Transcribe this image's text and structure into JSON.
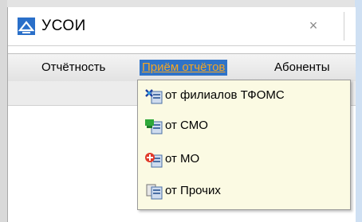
{
  "window": {
    "title": "УСОИ",
    "close_label": "×"
  },
  "menubar": {
    "items": [
      {
        "label": "Отчётность"
      },
      {
        "label": "Приём отчётов"
      },
      {
        "label": "Абоненты"
      }
    ]
  },
  "dropdown": {
    "items": [
      {
        "label": "от филиалов ТФОМС",
        "icon": "tfoms-branches-icon"
      },
      {
        "label": "от СМО",
        "icon": "smo-icon"
      },
      {
        "label": "от МО",
        "icon": "mo-icon"
      },
      {
        "label": "от Прочих",
        "icon": "others-icon"
      }
    ]
  },
  "colors": {
    "accent": "#2f73c8",
    "active_menu_text": "#f5a623",
    "dropdown_bg": "#fbfae3"
  }
}
